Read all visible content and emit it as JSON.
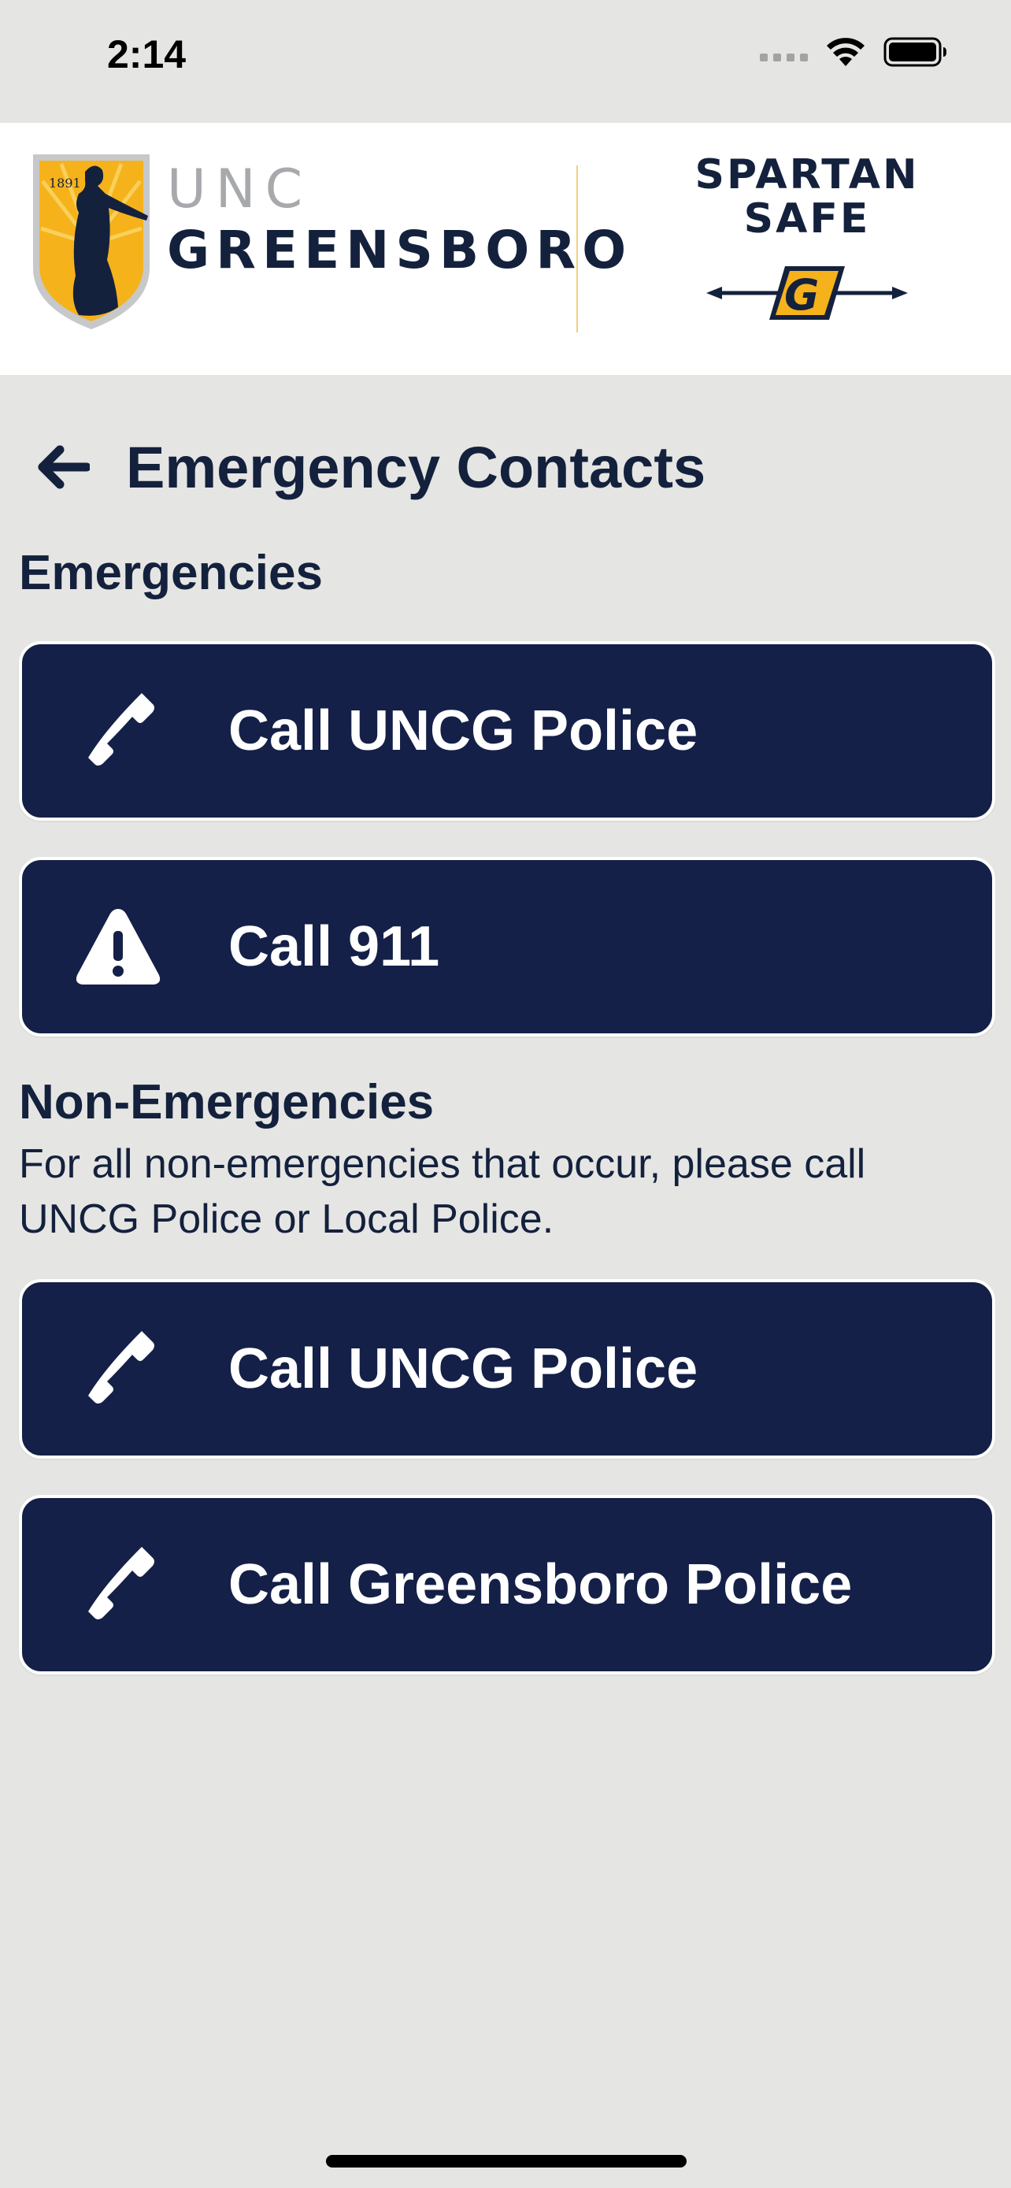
{
  "status_bar": {
    "time": "2:14",
    "icons": [
      "cellular-signal-icon",
      "wifi-icon",
      "battery-icon"
    ]
  },
  "brand": {
    "uncg_line1": "UNC",
    "uncg_line2": "GREENSBORO",
    "seal_years": "1891",
    "app_line1": "SPARTAN",
    "app_line2": "SAFE",
    "app_glyph": "G",
    "colors": {
      "navy": "#14213d",
      "gold": "#f5b21b",
      "gray": "#a7a9ac"
    }
  },
  "page": {
    "title": "Emergency Contacts",
    "back_icon": "arrow-left-icon"
  },
  "emergencies": {
    "title": "Emergencies",
    "buttons": [
      {
        "label": "Call UNCG Police",
        "icon": "phone-icon"
      },
      {
        "label": "Call 911",
        "icon": "warning-icon"
      }
    ]
  },
  "non_emergencies": {
    "title": "Non-Emergencies",
    "description": "For all non-emergencies that occur, please call UNCG Police or Local Police.",
    "buttons": [
      {
        "label": "Call UNCG Police",
        "icon": "phone-icon"
      },
      {
        "label": "Call Greensboro Police",
        "icon": "phone-icon"
      }
    ]
  },
  "colors": {
    "background": "#e5e5e3",
    "button": "#142047",
    "button_text": "#ffffff",
    "text": "#14213d"
  }
}
